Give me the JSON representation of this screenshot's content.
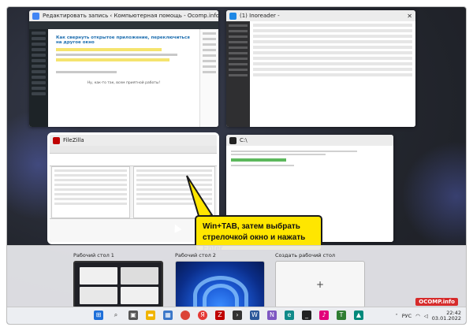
{
  "windows": {
    "wordpress": {
      "title": "Редактировать запись ‹ Компьютерная помощь - Ocomp.info — WordP...",
      "heading": "Как свернуть открытое приложение, переключиться на другое окно",
      "footer_text": "Ну, как-то так, всем приятной работы!"
    },
    "inoreader": {
      "title": "(1) Inoreader -"
    },
    "filezilla": {
      "title": "FileZilla"
    },
    "cmd": {
      "title": "C:\\"
    }
  },
  "callout": {
    "line1": "Win+TAB, затем выбрать",
    "line2": "стрелочкой окно и нажать Enter"
  },
  "desktops": [
    {
      "label": "Рабочий стол 1"
    },
    {
      "label": "Рабочий стол 2"
    },
    {
      "label": "Создать рабочий стол",
      "plus": "+"
    }
  ],
  "taskbar": {
    "icons": [
      "windows-start-icon",
      "search-icon",
      "task-view-icon",
      "explorer-icon",
      "store-icon",
      "chrome-icon",
      "yandex-icon",
      "filezilla-icon",
      "terminal-icon",
      "word-icon",
      "notes-icon",
      "edge-icon",
      "cmd-icon",
      "media-icon",
      "totalcmd-icon",
      "photo-icon"
    ],
    "lang": "РУС",
    "time": "22:42",
    "date": "03.01.2022"
  },
  "watermark": "OCOMP.info",
  "colors": {
    "callout": "#ffe600",
    "wp_link": "#2271b1",
    "taskbar": "#eceef2"
  }
}
